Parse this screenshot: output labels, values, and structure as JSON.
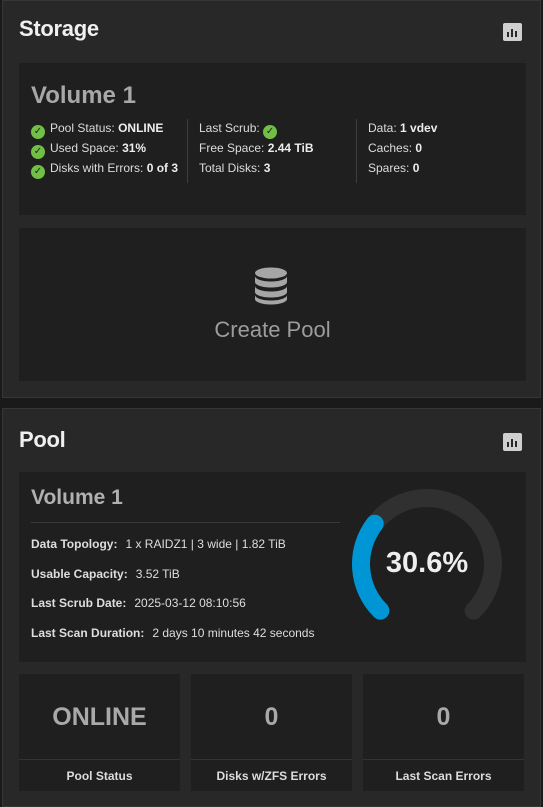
{
  "storage": {
    "title": "Storage",
    "volume": {
      "name": "Volume 1",
      "pool_status_label": "Pool Status:",
      "pool_status_value": "ONLINE",
      "used_space_label": "Used Space:",
      "used_space_value": "31%",
      "disks_errors_label": "Disks with Errors:",
      "disks_errors_value": "0 of 3",
      "last_scrub_label": "Last Scrub:",
      "free_space_label": "Free Space:",
      "free_space_value": "2.44 TiB",
      "total_disks_label": "Total Disks:",
      "total_disks_value": "3",
      "data_label": "Data:",
      "data_value": "1 vdev",
      "caches_label": "Caches:",
      "caches_value": "0",
      "spares_label": "Spares:",
      "spares_value": "0"
    },
    "create_pool_label": "Create Pool"
  },
  "pool": {
    "title": "Pool",
    "name": "Volume 1",
    "details": [
      {
        "label": "Data Topology:",
        "value": "1 x RAIDZ1 | 3 wide | 1.82 TiB"
      },
      {
        "label": "Usable Capacity:",
        "value": "3.52 TiB"
      },
      {
        "label": "Last Scrub Date:",
        "value": "2025-03-12 08:10:56"
      },
      {
        "label": "Last Scan Duration:",
        "value": "2 days 10 minutes 42 seconds"
      }
    ],
    "usage": {
      "percent": 30.6,
      "label": "30.6%"
    },
    "stats": [
      {
        "value": "ONLINE",
        "label": "Pool Status"
      },
      {
        "value": "0",
        "label": "Disks w/ZFS Errors"
      },
      {
        "value": "0",
        "label": "Last Scan Errors"
      }
    ]
  },
  "colors": {
    "ok_green": "#71bf44",
    "gauge_fill": "#0095d5",
    "gauge_track": "#303030"
  },
  "icons": [
    "chart-icon",
    "check-circle-icon",
    "database-icon"
  ]
}
